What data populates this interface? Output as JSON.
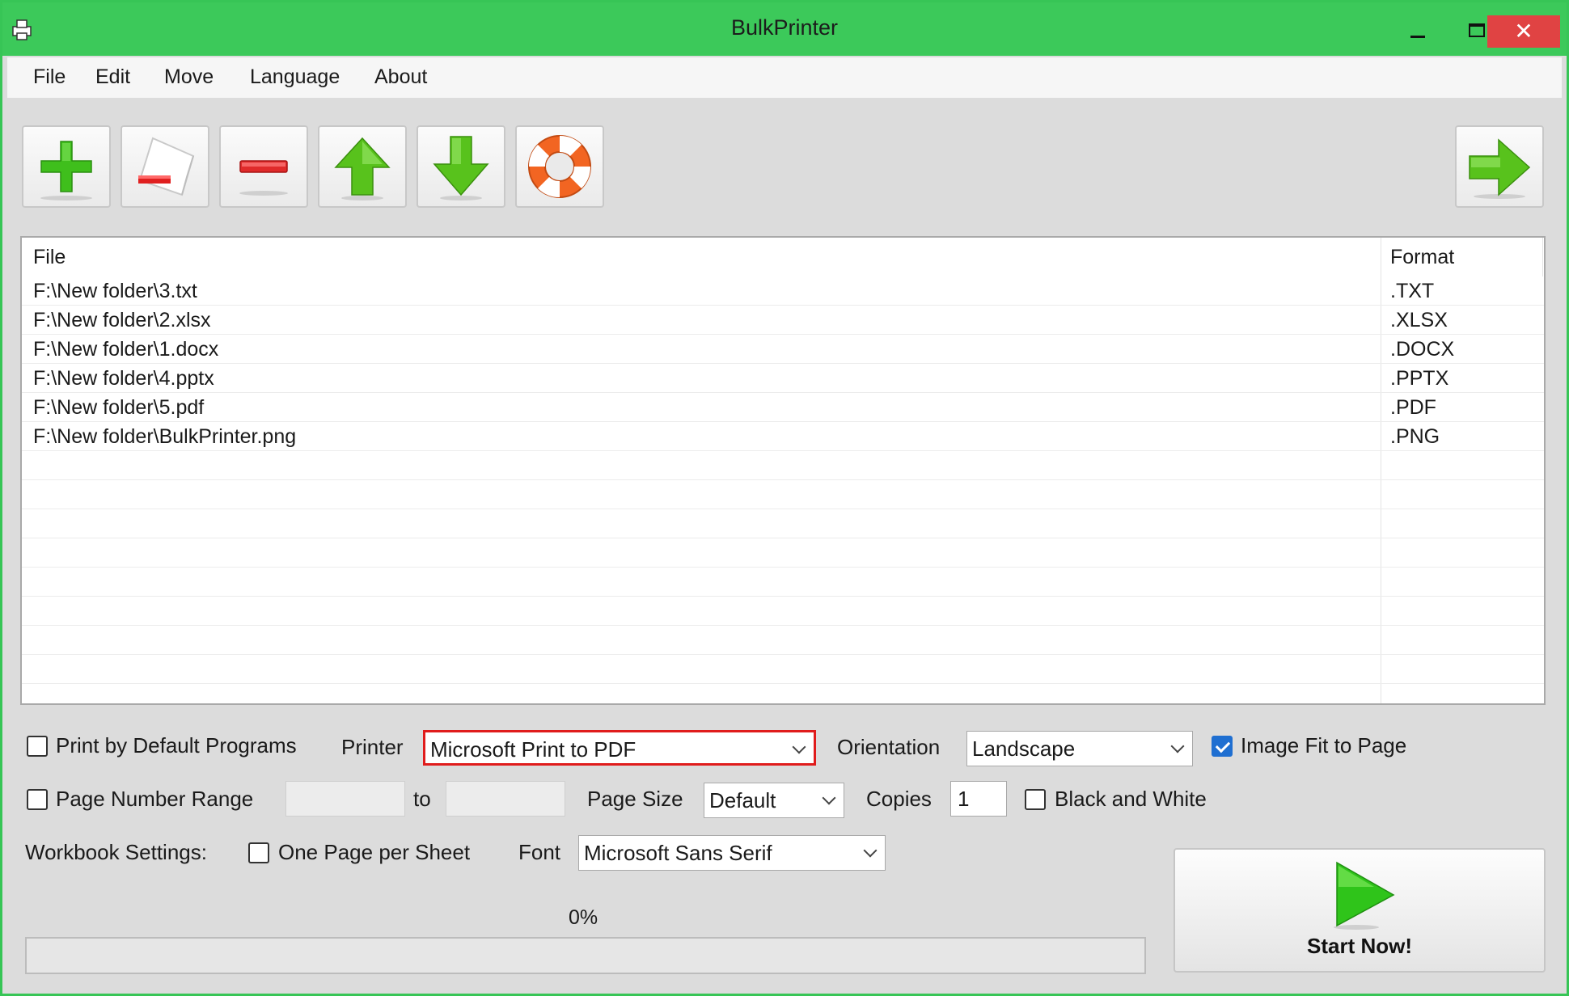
{
  "window": {
    "title": "BulkPrinter"
  },
  "menu": [
    "File",
    "Edit",
    "Move",
    "Language",
    "About"
  ],
  "toolbar": {
    "buttons": [
      {
        "name": "add-files-button",
        "icon": "plus-icon"
      },
      {
        "name": "remove-file-button",
        "icon": "document-remove-icon"
      },
      {
        "name": "clear-list-button",
        "icon": "minus-icon"
      },
      {
        "name": "move-up-button",
        "icon": "arrow-up-icon"
      },
      {
        "name": "move-down-button",
        "icon": "arrow-down-icon"
      },
      {
        "name": "help-button",
        "icon": "lifebuoy-icon"
      },
      {
        "name": "next-button",
        "icon": "arrow-right-icon"
      }
    ]
  },
  "file_list": {
    "columns": [
      "File",
      "Format"
    ],
    "rows": [
      {
        "file": "F:\\New folder\\3.txt",
        "format": ".TXT"
      },
      {
        "file": "F:\\New folder\\2.xlsx",
        "format": ".XLSX"
      },
      {
        "file": "F:\\New folder\\1.docx",
        "format": ".DOCX"
      },
      {
        "file": "F:\\New folder\\4.pptx",
        "format": ".PPTX"
      },
      {
        "file": "F:\\New folder\\5.pdf",
        "format": ".PDF"
      },
      {
        "file": "F:\\New folder\\BulkPrinter.png",
        "format": ".PNG"
      }
    ]
  },
  "options": {
    "print_default_label": "Print by Default Programs",
    "print_default_checked": false,
    "printer_label": "Printer",
    "printer_value": "Microsoft Print to PDF",
    "orientation_label": "Orientation",
    "orientation_value": "Landscape",
    "image_fit_label": "Image Fit to Page",
    "image_fit_checked": true,
    "page_range_label": "Page Number Range",
    "page_range_checked": false,
    "page_range_from": "",
    "page_range_to_label": "to",
    "page_range_to": "",
    "page_size_label": "Page Size",
    "page_size_value": "Default",
    "copies_label": "Copies",
    "copies_value": "1",
    "bw_label": "Black and White",
    "bw_checked": false,
    "workbook_label": "Workbook Settings:",
    "one_page_label": "One Page per Sheet",
    "one_page_checked": false,
    "font_label": "Font",
    "font_value": "Microsoft Sans Serif"
  },
  "progress": {
    "label": "0%",
    "value": 0
  },
  "start": {
    "label": "Start Now!"
  },
  "colors": {
    "titlebar": "#3cc95a",
    "close": "#e04343",
    "highlight_border": "#e01c1c",
    "checkbox_checked": "#1f6fd1"
  }
}
